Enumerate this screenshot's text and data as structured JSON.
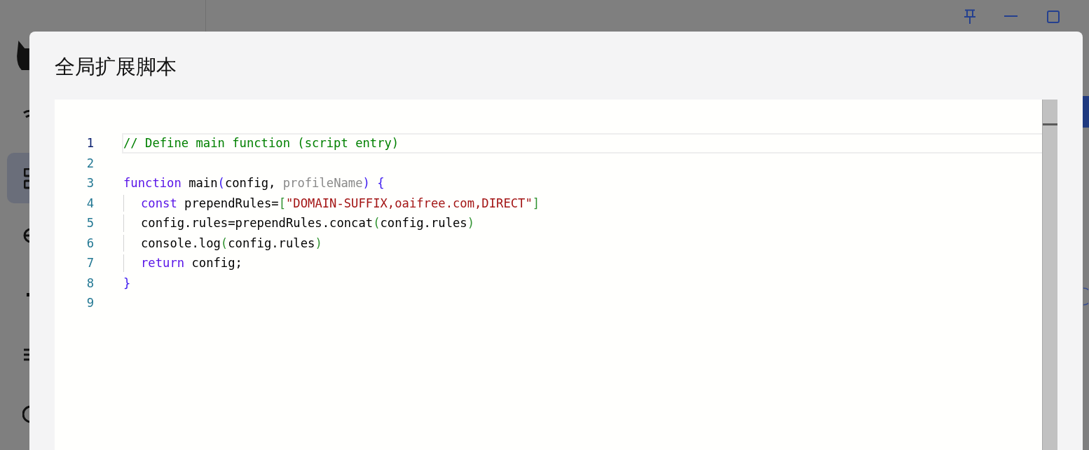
{
  "dialog": {
    "title": "全局扩展脚本"
  },
  "editor": {
    "lines": [
      {
        "number": "1",
        "selected": true,
        "indented": false,
        "tokens": [
          {
            "kind": "comment",
            "text": "// Define main function (script entry)"
          }
        ]
      },
      {
        "number": "2",
        "selected": false,
        "indented": false
      },
      {
        "number": "3",
        "selected": false,
        "indented": false,
        "tokens": [
          {
            "kind": "keyword",
            "text": "function"
          },
          {
            "kind": "plain",
            "text": " main"
          },
          {
            "kind": "bracket",
            "text": "("
          },
          {
            "kind": "plain",
            "text": "config, "
          },
          {
            "kind": "unused",
            "text": "profileName"
          },
          {
            "kind": "bracket",
            "text": ")"
          },
          {
            "kind": "bracket",
            "text": " {"
          }
        ]
      },
      {
        "number": "4",
        "selected": false,
        "indented": true,
        "tokens": [
          {
            "kind": "keyword",
            "text": "const"
          },
          {
            "kind": "plain",
            "text": " prependRules="
          },
          {
            "kind": "bracket2",
            "text": "["
          },
          {
            "kind": "string",
            "text": "\"DOMAIN-SUFFIX,oaifree.com,DIRECT\""
          },
          {
            "kind": "bracket2",
            "text": "]"
          }
        ]
      },
      {
        "number": "5",
        "selected": false,
        "indented": true,
        "tokens": [
          {
            "kind": "plain",
            "text": "config.rules=prependRules.concat"
          },
          {
            "kind": "bracket2",
            "text": "("
          },
          {
            "kind": "plain",
            "text": "config.rules"
          },
          {
            "kind": "bracket2",
            "text": ")"
          }
        ]
      },
      {
        "number": "6",
        "selected": false,
        "indented": true,
        "tokens": [
          {
            "kind": "plain",
            "text": "console.log"
          },
          {
            "kind": "bracket2",
            "text": "("
          },
          {
            "kind": "plain",
            "text": "config.rules"
          },
          {
            "kind": "bracket2",
            "text": ")"
          }
        ]
      },
      {
        "number": "7",
        "selected": false,
        "indented": true,
        "tokens": [
          {
            "kind": "keyword",
            "text": "return"
          },
          {
            "kind": "plain",
            "text": " config;"
          }
        ]
      },
      {
        "number": "8",
        "selected": false,
        "indented": false,
        "tokens": [
          {
            "kind": "bracket",
            "text": "}"
          }
        ]
      },
      {
        "number": "9",
        "selected": false,
        "indented": false
      }
    ]
  }
}
